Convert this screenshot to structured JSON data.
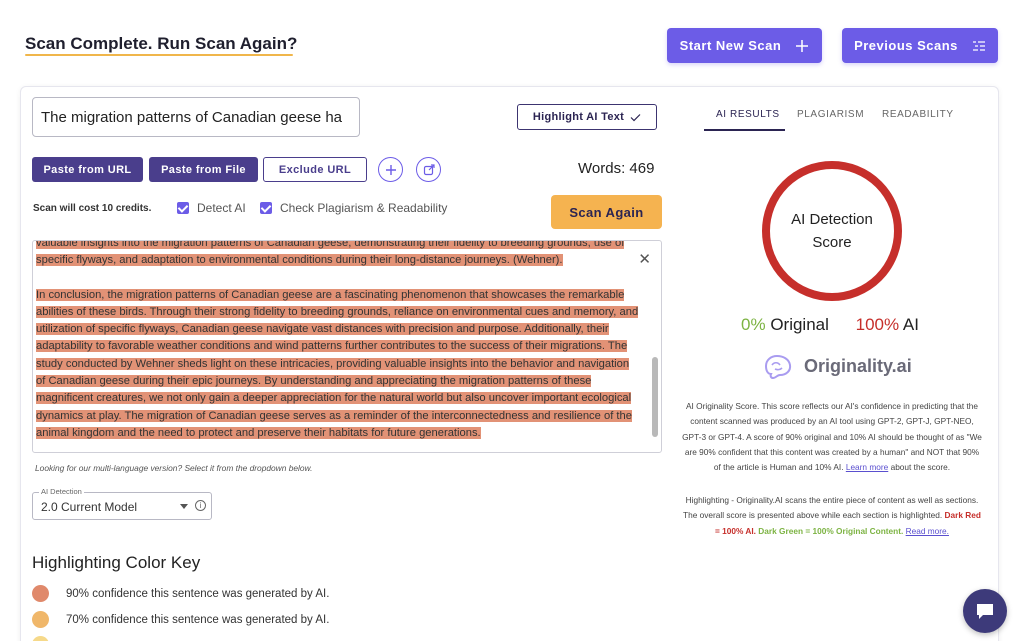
{
  "header": {
    "title": "Scan Complete. Run Scan Again?",
    "start_new_scan": "Start New Scan",
    "previous_scans": "Previous Scans"
  },
  "editor": {
    "title_value": "The migration patterns of Canadian geese ha",
    "highlight_ai_text": "Highlight AI Text",
    "paste_from_url": "Paste from URL",
    "paste_from_file": "Paste from File",
    "exclude_url": "Exclude URL",
    "words": "Words: 469",
    "scan_cost": "Scan will cost 10 credits.",
    "detect_ai": "Detect AI",
    "check_plagiarism": "Check Plagiarism & Readability",
    "scan_again": "Scan Again",
    "text_line_top": "valuable insights into the migration patterns of Canadian geese, demonstrating their fidelity to breeding grounds, use of specific flyways, and adaptation to environmental conditions during their long-distance journeys. (Wehner).",
    "text_paragraph": "In conclusion, the migration patterns of Canadian geese are a fascinating phenomenon that showcases the remarkable abilities of these birds. Through their strong fidelity to breeding grounds, reliance on environmental cues and memory, and utilization of specific flyways, Canadian geese navigate vast distances with precision and purpose. Additionally, their adaptability to favorable weather conditions and wind patterns further contributes to the success of their migrations. The study conducted by Wehner sheds light on these intricacies, providing valuable insights into the behavior and navigation of Canadian geese during their epic journeys. By understanding and appreciating the migration patterns of these magnificent creatures, we not only gain a deeper appreciation for the natural world but also uncover important ecological dynamics at play. The migration of Canadian geese serves as a reminder of the interconnectedness and resilience of the animal kingdom and the need to protect and preserve their habitats for future generations.",
    "multi_lang_note": "Looking for our multi-language version? Select it from the dropdown below.",
    "model_label": "AI Detection",
    "model_value": "2.0 Current Model"
  },
  "color_key": {
    "title": "Highlighting Color Key",
    "items": [
      {
        "label": "90% confidence this sentence was generated by AI.",
        "color": "#e0896b"
      },
      {
        "label": "70% confidence this sentence was generated by AI.",
        "color": "#f0b76a"
      },
      {
        "label": "",
        "color": "#f6d98a"
      }
    ]
  },
  "results": {
    "tabs": [
      "AI RESULTS",
      "PLAGIARISM",
      "READABILITY"
    ],
    "ring_line1": "AI Detection",
    "ring_line2": "Score",
    "original_pct": "0%",
    "original_label": "Original",
    "ai_pct": "100%",
    "ai_label": "AI",
    "logo_text": "Originality.ai",
    "score_desc": "AI Originality Score. This score reflects our AI's confidence in predicting that the content scanned was produced by an AI tool using GPT-2, GPT-J, GPT-NEO, GPT-3 or GPT-4. A score of 90% original and 10% AI should be thought of as \"We are 90% confident that this content was created by a human\" and NOT that 90% of the article is Human and 10% AI.",
    "learn_more": "Learn more",
    "about_score": "about the score.",
    "highlight_desc": "Highlighting - Originality.AI scans the entire piece of content as well as sections. The overall score is presented above while each section is highlighted.",
    "dark_red": "Dark Red = 100% AI.",
    "dark_green": "Dark Green = 100% Original Content.",
    "read_more": "Read more."
  },
  "colors": {
    "accent": "#6c5ce7",
    "button_dark": "#4a3e8c",
    "scan_again": "#f5b350",
    "ring": "#c62f2b",
    "highlight": "#e29276",
    "original_green": "#7cb342"
  },
  "icons": [
    "plus-icon",
    "list-icon",
    "check-icon",
    "add-circle-icon",
    "share-icon",
    "close-icon",
    "caret-down-icon",
    "info-icon",
    "brain-logo-icon",
    "chat-icon"
  ]
}
